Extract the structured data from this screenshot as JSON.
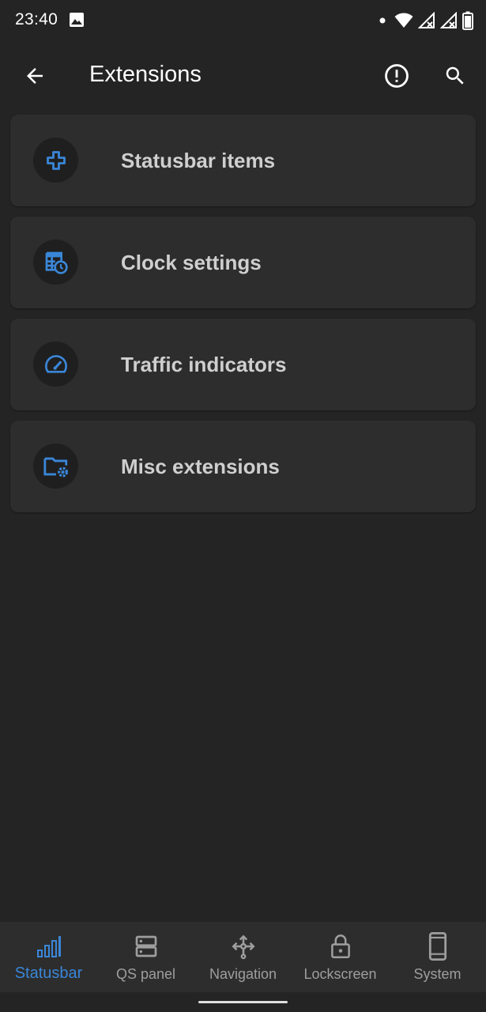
{
  "status_bar": {
    "time": "23:40",
    "icons": [
      "image-notification-icon",
      "dot-icon",
      "wifi-icon",
      "signal-no-sim-icon",
      "signal-no-sim-icon",
      "battery-icon"
    ]
  },
  "app_bar": {
    "title": "Extensions",
    "back_icon": "arrow-left-icon",
    "info_icon": "alert-circle-icon",
    "search_icon": "search-icon"
  },
  "cards": [
    {
      "label": "Statusbar items",
      "icon": "medical-cross-icon"
    },
    {
      "label": "Clock settings",
      "icon": "table-clock-icon"
    },
    {
      "label": "Traffic indicators",
      "icon": "speedometer-icon"
    },
    {
      "label": "Misc extensions",
      "icon": "folder-settings-icon"
    }
  ],
  "bottom_nav": {
    "items": [
      {
        "label": "Statusbar",
        "icon": "bar-chart-icon",
        "active": true
      },
      {
        "label": "QS panel",
        "icon": "server-icon",
        "active": false
      },
      {
        "label": "Navigation",
        "icon": "move-arrows-icon",
        "active": false
      },
      {
        "label": "Lockscreen",
        "icon": "lock-icon",
        "active": false
      },
      {
        "label": "System",
        "icon": "phone-icon",
        "active": false
      }
    ]
  },
  "colors": {
    "background": "#242424",
    "card": "#2d2d2d",
    "accent": "#3a86d8",
    "card_text": "#cfcfcf",
    "nav_inactive": "#9e9e9e"
  }
}
